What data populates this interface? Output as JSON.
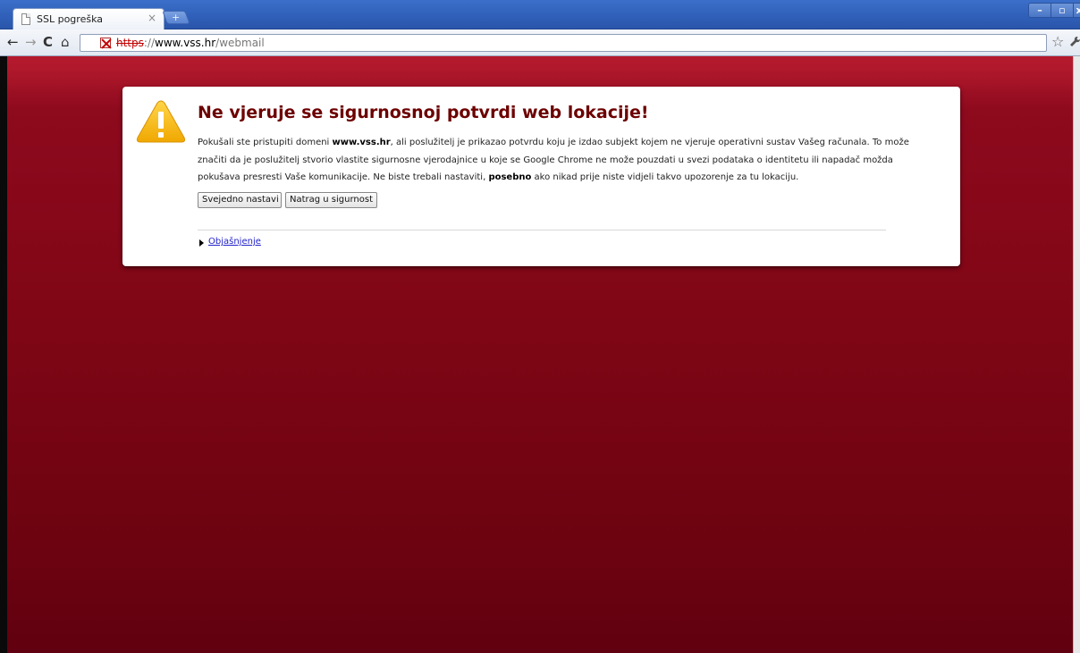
{
  "browser": {
    "tab_title": "SSL pogreška",
    "tab_close": "×",
    "new_tab": "+",
    "window_controls": {
      "minimize": "–",
      "maximize": "▫",
      "close": "x"
    },
    "url": {
      "scheme": "https",
      "sep": "://",
      "host": "www.vss.hr",
      "path": "/webmail"
    },
    "nav": {
      "back": "←",
      "forward": "→",
      "reload": "C",
      "home": "⌂"
    },
    "star": "☆",
    "wrench": "🔧"
  },
  "interstitial": {
    "title": "Ne vjeruje se sigurnosnoj potvrdi web lokacije!",
    "para_a": "Pokušali ste pristupiti domeni ",
    "domain": "www.vss.hr",
    "para_b": ", ali poslužitelj je prikazao potvrdu koju je izdao subjekt kojem ne vjeruje operativni sustav Vašeg računala. To može značiti da je poslužitelj stvorio vlastite sigurnosne vjerodajnice u koje se Google Chrome ne može pouzdati u svezi podataka o identitetu ili napadač možda pokušava presresti Vaše komunikacije. Ne biste trebali nastaviti, ",
    "emphasis": "posebno",
    "para_c": " ako nikad prije niste vidjeli takvo upozorenje za tu lokaciju.",
    "proceed_label": "Svejedno nastavi",
    "back_label": "Natrag u sigurnost",
    "explanation_label": "Objašnjenje"
  },
  "colors": {
    "background": "#7f0615",
    "title": "#6d0000",
    "link": "#2222cc",
    "warning_icon": "#f4b400"
  }
}
